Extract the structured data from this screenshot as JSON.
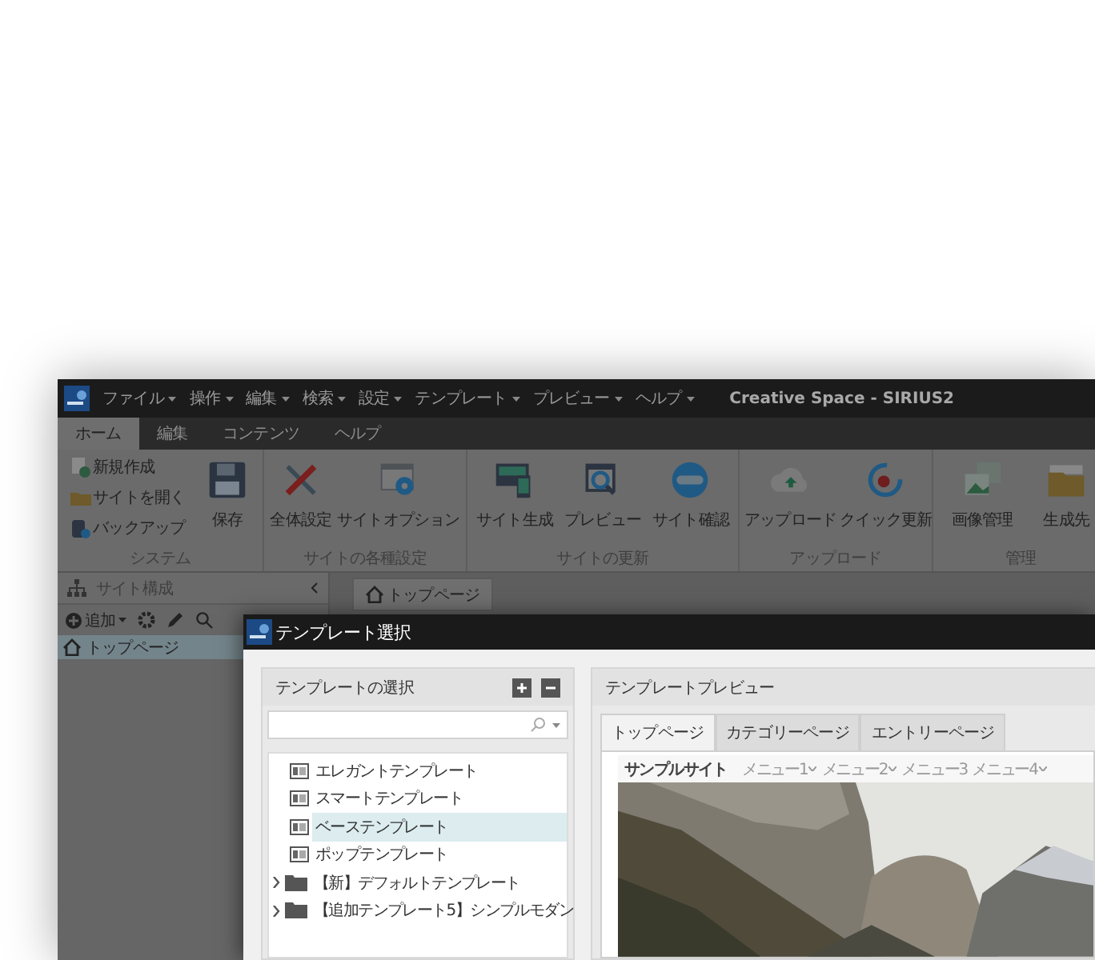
{
  "menubar": {
    "items": [
      "ファイル",
      "操作",
      "編集",
      "検索",
      "設定",
      "テンプレート",
      "プレビュー",
      "ヘルプ"
    ],
    "title": "Creative Space - SIRIUS2"
  },
  "ribbon_tabs": [
    {
      "label": "ホーム",
      "selected": true
    },
    {
      "label": "編集",
      "selected": false
    },
    {
      "label": "コンテンツ",
      "selected": false
    },
    {
      "label": "ヘルプ",
      "selected": false
    }
  ],
  "ribbon_groups": [
    {
      "label": "システム",
      "small_items": [
        {
          "label": "新規作成"
        },
        {
          "label": "サイトを開く"
        },
        {
          "label": "バックアップ"
        }
      ],
      "items": [
        {
          "label": "保存"
        }
      ]
    },
    {
      "label": "サイトの各種設定",
      "items": [
        {
          "label": "全体設定"
        },
        {
          "label": "サイトオプション"
        }
      ]
    },
    {
      "label": "サイトの更新",
      "items": [
        {
          "label": "サイト生成"
        },
        {
          "label": "プレビュー"
        },
        {
          "label": "サイト確認"
        }
      ]
    },
    {
      "label": "アップロード",
      "items": [
        {
          "label": "アップロード"
        },
        {
          "label": "クイック更新"
        }
      ]
    },
    {
      "label": "管理",
      "items": [
        {
          "label": "画像管理"
        },
        {
          "label": "生成先"
        }
      ]
    }
  ],
  "sidebar": {
    "title": "サイト構成",
    "add_button": "追加",
    "tree": [
      {
        "label": "トップページ",
        "selected": true
      }
    ]
  },
  "editor_tabs": [
    {
      "label": "トップページ"
    }
  ],
  "dialog": {
    "title": "テンプレート選択",
    "template_panel": {
      "title": "テンプレートの選択",
      "items": [
        {
          "kind": "template",
          "label": "エレガントテンプレート",
          "selected": false
        },
        {
          "kind": "template",
          "label": "スマートテンプレート",
          "selected": false
        },
        {
          "kind": "template",
          "label": "ベーステンプレート",
          "selected": true
        },
        {
          "kind": "template",
          "label": "ポップテンプレート",
          "selected": false
        },
        {
          "kind": "folder",
          "label": "【新】デフォルトテンプレート",
          "selected": false,
          "expanded": false
        },
        {
          "kind": "folder",
          "label": "【追加テンプレート5】シンプルモダン",
          "selected": false,
          "expanded": false
        }
      ]
    },
    "preview_panel": {
      "title": "テンプレートプレビュー",
      "tabs": [
        {
          "label": "トップページ",
          "selected": true
        },
        {
          "label": "カテゴリーページ",
          "selected": false
        },
        {
          "label": "エントリーページ",
          "selected": false
        }
      ],
      "site": {
        "name": "サンプルサイト",
        "menu": [
          {
            "label": "メニュー1",
            "dropdown": true
          },
          {
            "label": "メニュー2",
            "dropdown": true
          },
          {
            "label": "メニュー3",
            "dropdown": false
          },
          {
            "label": "メニュー4",
            "dropdown": true
          }
        ]
      }
    }
  }
}
